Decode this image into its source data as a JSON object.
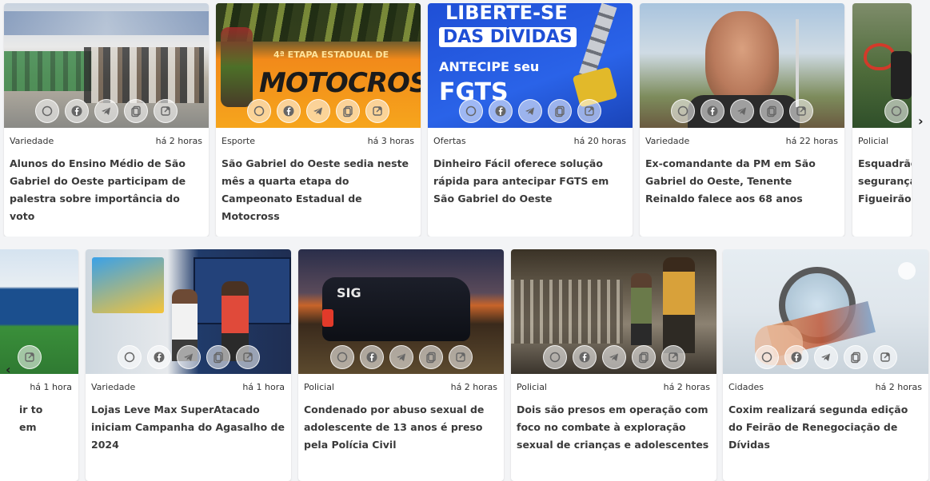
{
  "carousel_top": {
    "cards": [
      {
        "category": "Variedade",
        "time": "há 2 horas",
        "title": "Alunos do Ensino Médio de São Gabriel do Oeste participam de palestra sobre importância do voto"
      },
      {
        "category": "Esporte",
        "time": "há 3 horas",
        "title": "São Gabriel do Oeste sedia neste mês a quarta etapa do Campeonato Estadual de Motocross",
        "image_text": {
          "line1": "4ª ETAPA ESTADUAL DE",
          "line2": "MOTOCROSS"
        }
      },
      {
        "category": "Ofertas",
        "time": "há 20 horas",
        "title": "Dinheiro Fácil oferece solução rápida para antecipar FGTS em São Gabriel do Oeste",
        "image_text": {
          "line1": "LIBERTE-SE",
          "line2": "DAS DÍVIDAS",
          "line3": "ANTECIPE seu",
          "line4": "FGTS"
        }
      },
      {
        "category": "Variedade",
        "time": "há 22 horas",
        "title": "Ex-comandante da PM em São Gabriel do Oeste, Tenente Reinaldo falece aos 68 anos"
      },
      {
        "category": "Policial",
        "time": "",
        "title": "Esquadrão segurança Figueirão"
      }
    ],
    "next_arrow": "›"
  },
  "carousel_bottom": {
    "cards": [
      {
        "category": "",
        "time": "há 1 hora",
        "title": "ir to em"
      },
      {
        "category": "Variedade",
        "time": "há 1 hora",
        "title": "Lojas Leve Max SuperAtacado iniciam Campanha do Agasalho de 2024"
      },
      {
        "category": "Policial",
        "time": "há 2 horas",
        "title": "Condenado por abuso sexual de adolescente de 13 anos é preso pela Polícia Civil",
        "image_text": {
          "line1": "SIG"
        }
      },
      {
        "category": "Policial",
        "time": "há 2 horas",
        "title": "Dois são presos em operação com foco no combate à exploração sexual de crianças e adolescentes"
      },
      {
        "category": "Cidades",
        "time": "há 2 horas",
        "title": "Coxim realizará segunda edição do Feirão de Renegociação de Dívidas"
      }
    ],
    "prev_arrow": "‹"
  },
  "share_icons": [
    "whatsapp-icon",
    "facebook-icon",
    "telegram-icon",
    "copy-icon",
    "external-link-icon"
  ],
  "colors": {
    "accent_orange": "#f28a1a",
    "fgts_blue": "#1f4fd6",
    "card_bg": "#ffffff"
  }
}
